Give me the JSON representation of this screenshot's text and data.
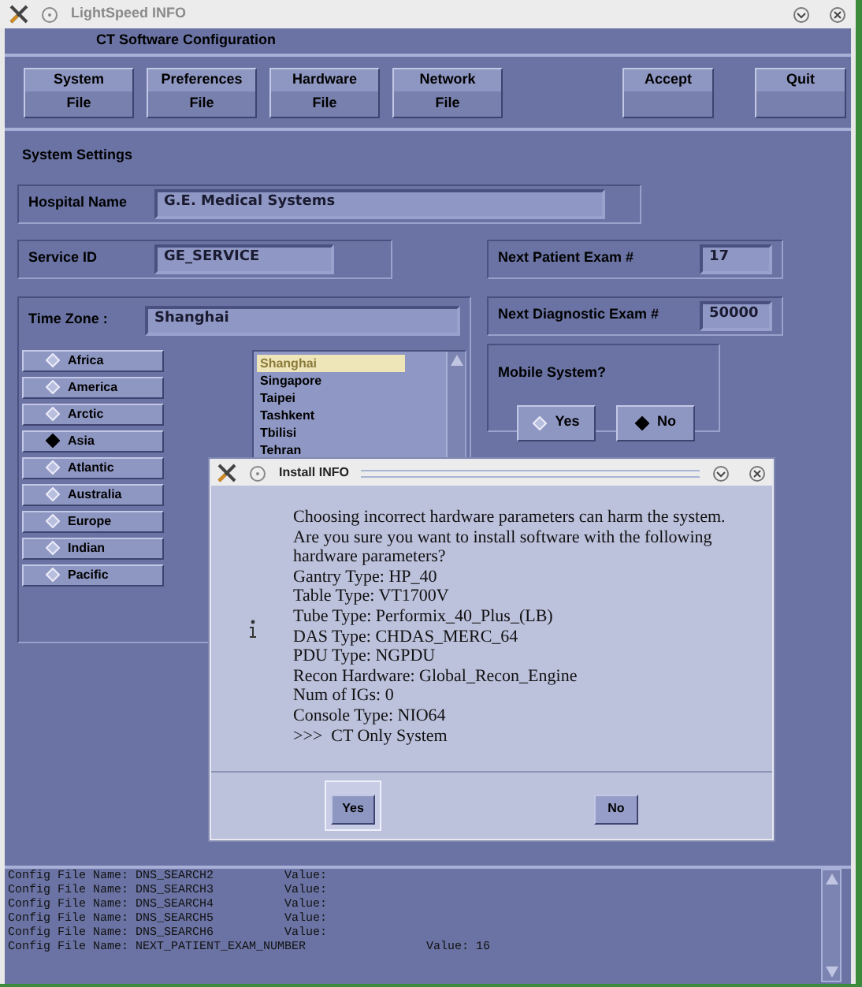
{
  "window": {
    "title": "LightSpeed INFO"
  },
  "header": {
    "title": "CT Software Configuration"
  },
  "toolbar": [
    {
      "label": "System",
      "sub": "File"
    },
    {
      "label": "Preferences",
      "sub": "File"
    },
    {
      "label": "Hardware",
      "sub": "File"
    },
    {
      "label": "Network",
      "sub": "File"
    },
    {
      "label": "Accept"
    },
    {
      "label": "Quit"
    }
  ],
  "section": "System Settings",
  "hospital": {
    "label": "Hospital Name",
    "value": "G.E. Medical Systems"
  },
  "service": {
    "label": "Service ID",
    "value": "GE_SERVICE"
  },
  "next_patient": {
    "label": "Next Patient Exam #",
    "value": "17"
  },
  "next_diagnostic": {
    "label": "Next Diagnostic Exam #",
    "value": "50000"
  },
  "time_zone": {
    "label": "Time Zone :",
    "value": "Shanghai",
    "regions": [
      {
        "label": "Africa",
        "selected": false
      },
      {
        "label": "America",
        "selected": false
      },
      {
        "label": "Arctic",
        "selected": false
      },
      {
        "label": "Asia",
        "selected": true
      },
      {
        "label": "Atlantic",
        "selected": false
      },
      {
        "label": "Australia",
        "selected": false
      },
      {
        "label": "Europe",
        "selected": false
      },
      {
        "label": "Indian",
        "selected": false
      },
      {
        "label": "Pacific",
        "selected": false
      }
    ],
    "zones": [
      {
        "label": "Shanghai",
        "selected": true
      },
      {
        "label": "Singapore",
        "selected": false
      },
      {
        "label": "Taipei",
        "selected": false
      },
      {
        "label": "Tashkent",
        "selected": false
      },
      {
        "label": "Tbilisi",
        "selected": false
      },
      {
        "label": "Tehran",
        "selected": false
      }
    ]
  },
  "mobile": {
    "label": "Mobile System?",
    "options": [
      {
        "label": "Yes",
        "selected": false
      },
      {
        "label": "No",
        "selected": true
      }
    ]
  },
  "log": [
    "Config File Name: DNS_SEARCH2          Value:",
    "Config File Name: DNS_SEARCH3          Value:",
    "Config File Name: DNS_SEARCH4          Value:",
    "Config File Name: DNS_SEARCH5          Value:",
    "Config File Name: DNS_SEARCH6          Value:",
    "Config File Name: NEXT_PATIENT_EXAM_NUMBER                 Value: 16"
  ],
  "dialog": {
    "title": "Install INFO",
    "message": "Choosing incorrect hardware parameters can harm the system. Are you sure you want to install software with the following hardware parameters?",
    "details": [
      "Gantry Type: HP_40",
      "Table Type: VT1700V",
      "Tube Type: Performix_40_Plus_(LB)",
      "DAS Type: CHDAS_MERC_64",
      "PDU Type: NGPDU",
      "Recon Hardware: Global_Recon_Engine",
      "Num of IGs: 0",
      "Console Type: NIO64",
      ">>>  CT Only System"
    ],
    "buttons": [
      {
        "label": "Yes",
        "selected": true
      },
      {
        "label": "No",
        "selected": false
      }
    ]
  }
}
